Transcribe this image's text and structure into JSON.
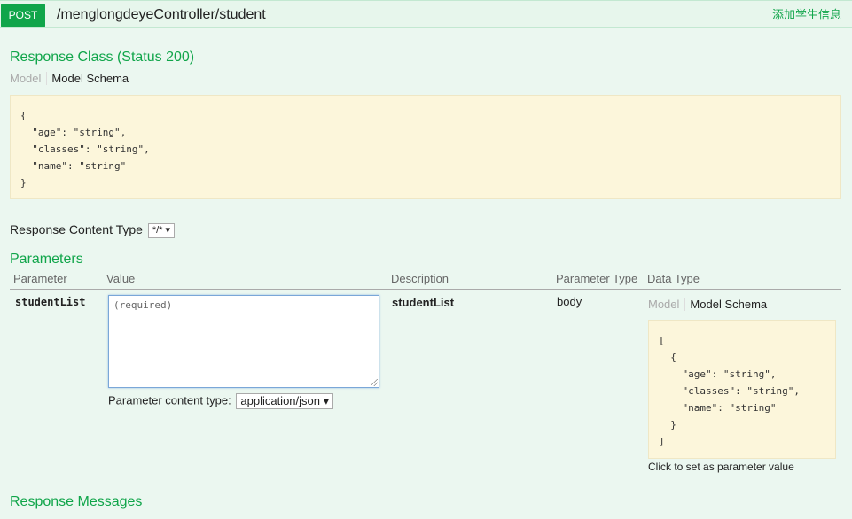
{
  "operation": {
    "method": "POST",
    "path": "/menglongdeyeController/student",
    "summary": "添加学生信息"
  },
  "response_class": {
    "title": "Response Class (Status 200)",
    "tab_model": "Model",
    "tab_schema": "Model Schema",
    "schema": "{\n  \"age\": \"string\",\n  \"classes\": \"string\",\n  \"name\": \"string\"\n}"
  },
  "response_content_type": {
    "label": "Response Content Type",
    "selected": "*/*"
  },
  "parameters": {
    "title": "Parameters",
    "columns": [
      "Parameter",
      "Value",
      "Description",
      "Parameter Type",
      "Data Type"
    ],
    "rows": [
      {
        "name": "studentList",
        "placeholder": "(required)",
        "description": "studentList",
        "param_type": "body",
        "content_type_label": "Parameter content type:",
        "content_type_selected": "application/json",
        "tab_model": "Model",
        "tab_schema": "Model Schema",
        "schema": "[\n  {\n    \"age\": \"string\",\n    \"classes\": \"string\",\n    \"name\": \"string\"\n  }\n]",
        "hint": "Click to set as parameter value"
      }
    ]
  },
  "response_messages": {
    "title": "Response Messages"
  }
}
